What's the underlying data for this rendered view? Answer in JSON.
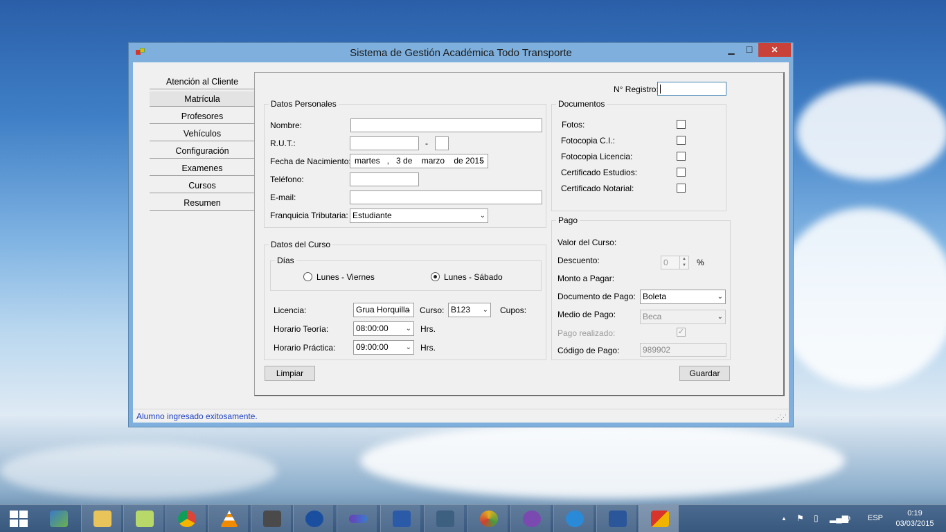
{
  "window": {
    "title": "Sistema de Gestión Académica Todo Transporte",
    "minimize": "▁",
    "maximize": "☐",
    "close": "✕"
  },
  "nav": {
    "items": [
      {
        "label": "Atención al Cliente"
      },
      {
        "label": "Matrícula"
      },
      {
        "label": "Profesores"
      },
      {
        "label": "Vehículos"
      },
      {
        "label": "Configuración"
      },
      {
        "label": "Examenes"
      },
      {
        "label": "Cursos"
      },
      {
        "label": "Resumen"
      }
    ],
    "active": "Matrícula"
  },
  "registro": {
    "label": "N° Registro:",
    "value": ""
  },
  "datos_personales": {
    "title": "Datos Personales",
    "nombre_label": "Nombre:",
    "nombre_value": "",
    "rut_label": "R.U.T.:",
    "rut_value": "",
    "rut_sep": "-",
    "rut_dv": "",
    "fecha_label": "Fecha de Nacimiento:",
    "fecha_value": "martes   ,   3 de    marzo    de 2015",
    "telefono_label": "Teléfono:",
    "telefono_value": "",
    "email_label": "E-mail:",
    "email_value": "",
    "franquicia_label": "Franquicia Tributaria:",
    "franquicia_value": "Estudiante"
  },
  "datos_curso": {
    "title": "Datos del Curso",
    "dias_title": "Días",
    "opt_lv": "Lunes  - Viernes",
    "opt_ls": "Lunes - Sábado",
    "selected": "Lunes - Sábado",
    "licencia_label": "Licencia:",
    "licencia_value": "Grua Horquilla",
    "curso_label": "Curso:",
    "curso_value": "B123",
    "cupos_label": "Cupos:",
    "teoria_label": "Horario Teoría:",
    "teoria_value": "08:00:00",
    "practica_label": "Horario Práctica:",
    "practica_value": "09:00:00",
    "hrs": "Hrs."
  },
  "documentos": {
    "title": "Documentos",
    "items": [
      {
        "label": "Fotos:",
        "checked": false
      },
      {
        "label": "Fotocopia C.I.:",
        "checked": false
      },
      {
        "label": "Fotocopia Licencia:",
        "checked": false
      },
      {
        "label": "Certificado Estudios:",
        "checked": false
      },
      {
        "label": "Certificado Notarial:",
        "checked": false
      }
    ]
  },
  "pago": {
    "title": "Pago",
    "valor_label": "Valor del Curso:",
    "descuento_label": "Descuento:",
    "descuento_value": "0",
    "percent": "%",
    "monto_label": "Monto a Pagar:",
    "documento_label": "Documento de Pago:",
    "documento_value": "Boleta",
    "medio_label": "Medio de Pago:",
    "medio_value": "Beca",
    "realizado_label": "Pago realizado:",
    "realizado_checked": true,
    "check_glyph": "✓",
    "codigo_label": "Código de Pago:",
    "codigo_value": "989902"
  },
  "buttons": {
    "limpiar": "Limpiar",
    "guardar": "Guardar"
  },
  "status": {
    "text": "Alumno ingresado exitosamente."
  },
  "dropdown_arrow": "⌄",
  "taskbar": {
    "language": "ESP",
    "time": "0:19",
    "date": "03/03/2015",
    "tray_up": "▲",
    "apps": [
      "folder",
      "notes",
      "chrome",
      "vlc",
      "sublime",
      "bluetooth",
      "infinity",
      "powershell",
      "mysql-workbench",
      "android-tool",
      "github",
      "ie",
      "word",
      "winforms-app"
    ]
  }
}
